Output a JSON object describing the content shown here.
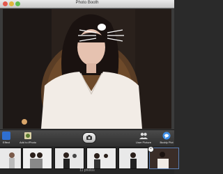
{
  "window": {
    "title": "Photo Booth"
  },
  "toolbar": {
    "effects_label": "Effect",
    "add_to_iphoto_label": "Add to iPhoto",
    "user_picture_label": "User Picture",
    "buddy_picture_label": "Buddy Pict"
  },
  "strip": {
    "count_label": "11 photos",
    "thumbnails": [
      "photo-1",
      "photo-2",
      "photo-3",
      "photo-4",
      "photo-5",
      "photo-6"
    ]
  }
}
